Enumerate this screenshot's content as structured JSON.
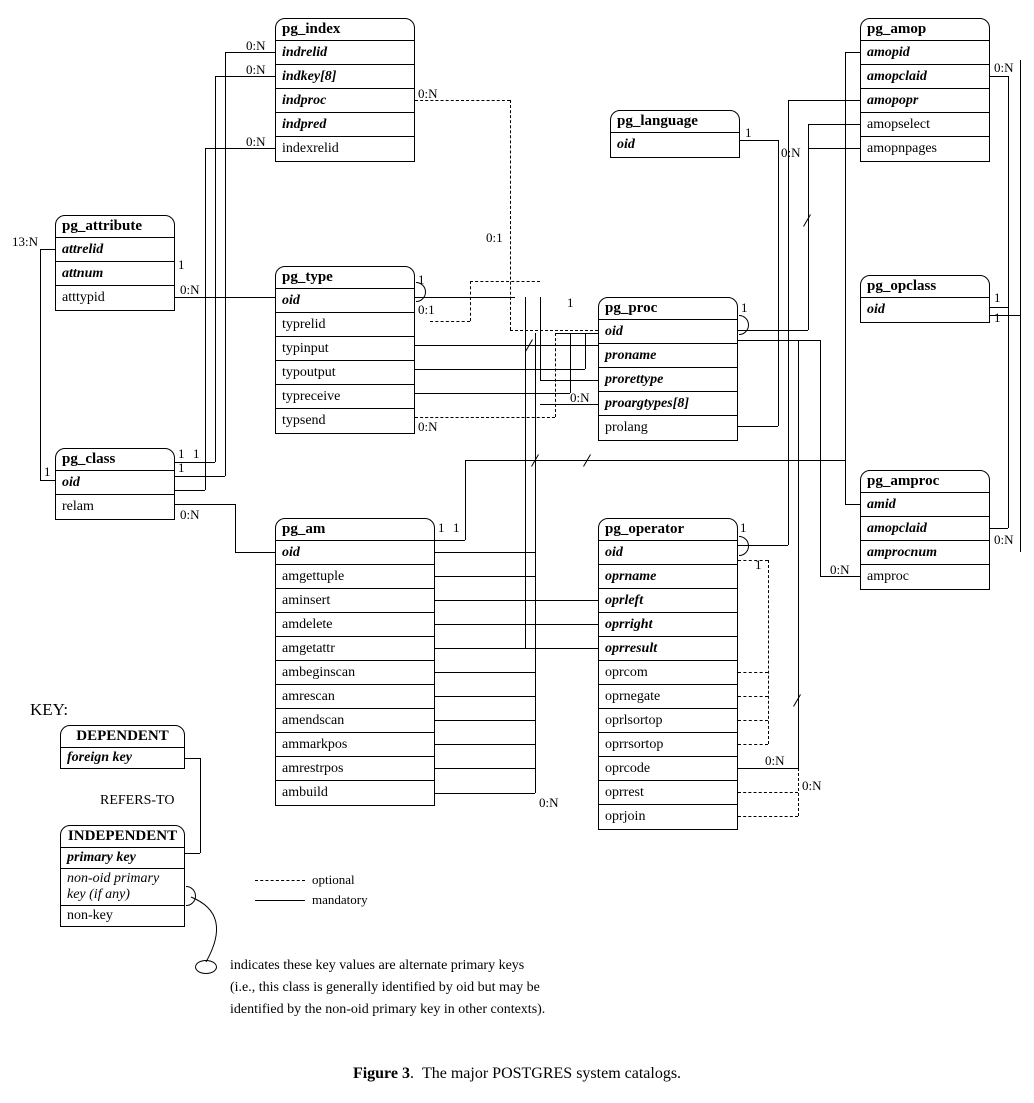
{
  "figure_caption": "Figure 3.  The major POSTGRES system catalogs.",
  "key": {
    "heading": "KEY:",
    "dependent": {
      "title": "DEPENDENT",
      "fk": "foreign key"
    },
    "refers_to": "REFERS-TO",
    "independent": {
      "title": "INDEPENDENT",
      "pk": "primary key",
      "alt": "non-oid primary",
      "alt2": " key (if any)",
      "nk": "non-key"
    },
    "optional": "optional",
    "mandatory": "mandatory",
    "ellipse_note1": "indicates these key values are alternate primary keys",
    "ellipse_note2": "(i.e., this class is generally identified by oid but may be",
    "ellipse_note3": "identified by the non-oid primary key in other contexts)."
  },
  "entities": {
    "pg_index": {
      "title": "pg_index",
      "attrs": [
        [
          "indrelid",
          "pk"
        ],
        [
          "indkey[8]",
          "pk"
        ],
        [
          "indproc",
          "pk"
        ],
        [
          "indpred",
          "pk"
        ],
        [
          "indexrelid",
          ""
        ]
      ]
    },
    "pg_attribute": {
      "title": "pg_attribute",
      "attrs": [
        [
          "attrelid",
          "pk"
        ],
        [
          "attnum",
          "pk"
        ],
        [
          "atttypid",
          ""
        ]
      ]
    },
    "pg_type": {
      "title": "pg_type",
      "attrs": [
        [
          "oid",
          "pk"
        ],
        [
          "typrelid",
          ""
        ],
        [
          "typinput",
          ""
        ],
        [
          "typoutput",
          ""
        ],
        [
          "typreceive",
          ""
        ],
        [
          "typsend",
          ""
        ]
      ]
    },
    "pg_language": {
      "title": "pg_language",
      "attrs": [
        [
          "oid",
          "pk"
        ]
      ]
    },
    "pg_amop": {
      "title": "pg_amop",
      "attrs": [
        [
          "amopid",
          "pk"
        ],
        [
          "amopclaid",
          "pk"
        ],
        [
          "amopopr",
          "pk"
        ],
        [
          "amopselect",
          ""
        ],
        [
          "amopnpages",
          ""
        ]
      ]
    },
    "pg_proc": {
      "title": "pg_proc",
      "attrs": [
        [
          "oid",
          "pk"
        ],
        [
          "proname",
          "pk"
        ],
        [
          "prorettype",
          "pk"
        ],
        [
          "proargtypes[8]",
          "pk"
        ],
        [
          "prolang",
          ""
        ]
      ]
    },
    "pg_opclass": {
      "title": "pg_opclass",
      "attrs": [
        [
          "oid",
          "pk"
        ]
      ]
    },
    "pg_class": {
      "title": "pg_class",
      "attrs": [
        [
          "oid",
          "pk"
        ],
        [
          "relam",
          ""
        ]
      ]
    },
    "pg_am": {
      "title": "pg_am",
      "attrs": [
        [
          "oid",
          "pk"
        ],
        [
          "amgettuple",
          ""
        ],
        [
          "aminsert",
          ""
        ],
        [
          "amdelete",
          ""
        ],
        [
          "amgetattr",
          ""
        ],
        [
          "ambeginscan",
          ""
        ],
        [
          "amrescan",
          ""
        ],
        [
          "amendscan",
          ""
        ],
        [
          "ammarkpos",
          ""
        ],
        [
          "amrestrpos",
          ""
        ],
        [
          "ambuild",
          ""
        ]
      ]
    },
    "pg_operator": {
      "title": "pg_operator",
      "attrs": [
        [
          "oid",
          "pk"
        ],
        [
          "oprname",
          "pk"
        ],
        [
          "oprleft",
          "pk"
        ],
        [
          "oprright",
          "pk"
        ],
        [
          "oprresult",
          "pk"
        ],
        [
          "oprcom",
          ""
        ],
        [
          "oprnegate",
          ""
        ],
        [
          "oprlsortop",
          ""
        ],
        [
          "oprrsortop",
          ""
        ],
        [
          "oprcode",
          ""
        ],
        [
          "oprrest",
          ""
        ],
        [
          "oprjoin",
          ""
        ]
      ]
    },
    "pg_amproc": {
      "title": "pg_amproc",
      "attrs": [
        [
          "amid",
          "pk"
        ],
        [
          "amopclaid",
          "pk"
        ],
        [
          "amprocnum",
          "pk"
        ],
        [
          "amproc",
          ""
        ]
      ]
    }
  },
  "cardinalities": {
    "n01": "0:1",
    "n0n": "0:N",
    "n1": "1",
    "n13n": "13:N"
  }
}
